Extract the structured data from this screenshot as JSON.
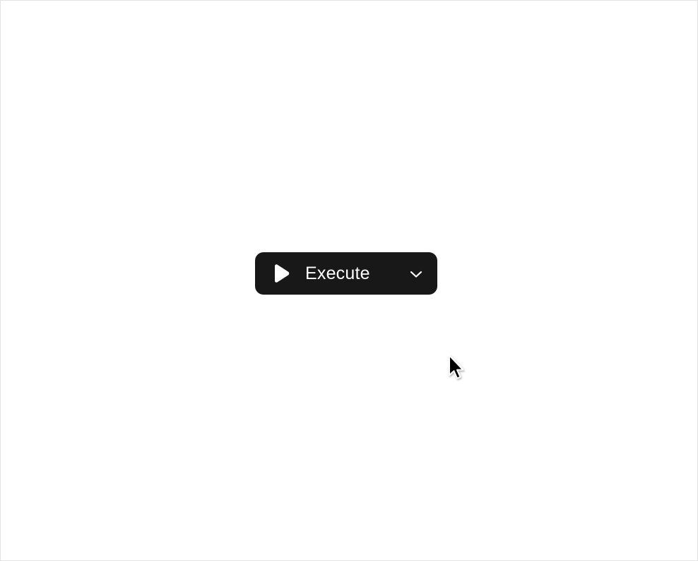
{
  "execute_control": {
    "label": "Execute",
    "play_icon": "play-icon",
    "dropdown_icon": "chevron-down-icon",
    "background_color": "#181818",
    "text_color": "#ffffff"
  },
  "pointer": {
    "icon": "arrow-cursor-icon"
  }
}
